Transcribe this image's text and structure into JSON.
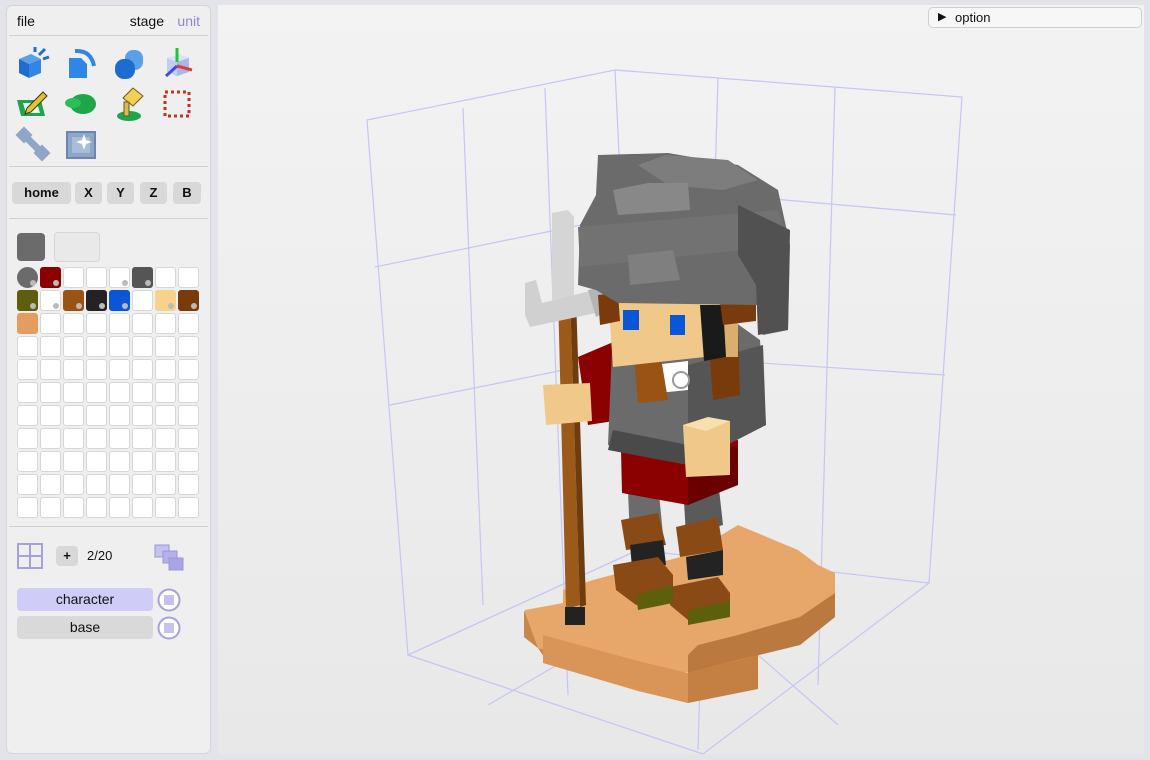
{
  "menu": {
    "file": "file",
    "stage": "stage",
    "unit": "unit"
  },
  "tools": [
    {
      "icon": "add-voxel-icon"
    },
    {
      "icon": "extrude-icon"
    },
    {
      "icon": "duplicate-icon"
    },
    {
      "icon": "move-gizmo-icon"
    },
    {
      "icon": "paint-icon"
    },
    {
      "icon": "fill-bucket-icon"
    },
    {
      "icon": "paint-brush-icon"
    },
    {
      "icon": "selection-box-icon"
    },
    {
      "icon": "wrench-icon"
    },
    {
      "icon": "shine-cube-icon"
    }
  ],
  "view_buttons": [
    "home",
    "X",
    "Y",
    "Z",
    "B"
  ],
  "colors": {
    "current": "#6b6b6b",
    "palette": [
      "#6b6b6b",
      "#8b0000",
      "",
      "",
      "",
      "#555555",
      "",
      "",
      "#5d5f0d",
      "",
      "#9a5315",
      "#232323",
      "#0a56d6",
      "",
      "#f6d28b",
      "#7a3b0c",
      "#e49d5e"
    ],
    "palette_dots": [
      0,
      1,
      4,
      5,
      8,
      9,
      10,
      11,
      12,
      14,
      15
    ]
  },
  "layers": {
    "add_label": "+",
    "count": "2/20",
    "items": [
      {
        "name": "character",
        "active": true
      },
      {
        "name": "base",
        "active": false
      }
    ]
  },
  "option": {
    "label": "option"
  }
}
